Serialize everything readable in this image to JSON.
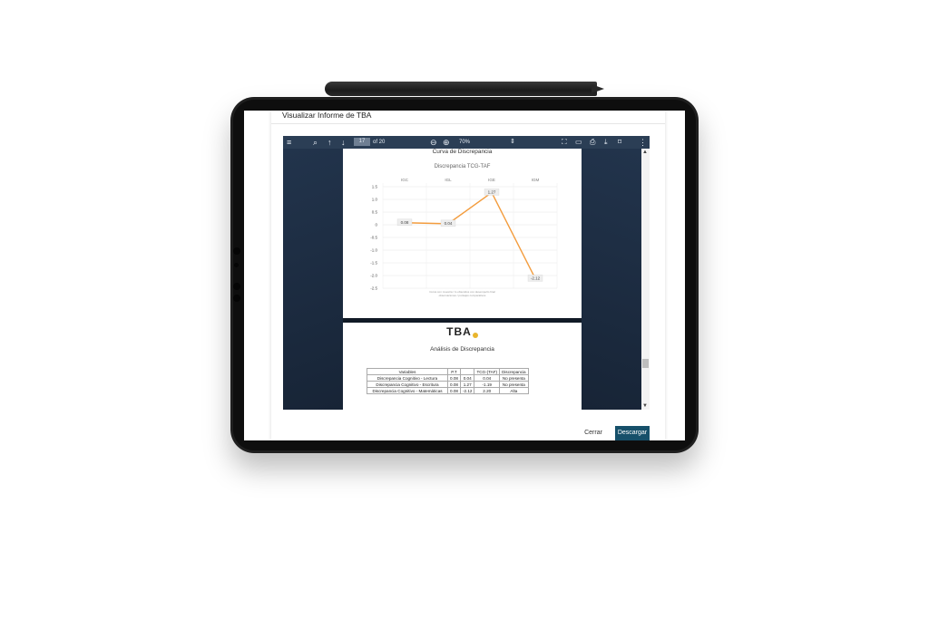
{
  "modal": {
    "title": "Visualizar Informe de TBA",
    "close_label": "Cerrar",
    "download_label": "Descargar"
  },
  "viewer": {
    "current_page": "17",
    "page_total": "of 20",
    "zoom": "70%",
    "icons": [
      "menu-icon",
      "search-icon",
      "arrow-up-icon",
      "arrow-down-icon",
      "zoom-out-icon",
      "zoom-in-icon",
      "fullscreen-icon",
      "open-folder-icon",
      "print-icon",
      "download-icon",
      "bookmark-icon",
      "more-icon"
    ]
  },
  "page1": {
    "heading": "Curva de Discrepancia",
    "note_line1": "Curva con muestra / lo obtenidos con desempeño final",
    "note_line2": "observaciones / puntajes comparativos"
  },
  "page2": {
    "logo_text": "TBA",
    "heading": "Análisis de Discrepancia",
    "table": {
      "headers": [
        "Variables",
        "P.T",
        "",
        "TCG-(TAF)",
        "Discrepancia"
      ],
      "rows": [
        [
          "Discrepancia Cognitivo - Lectura",
          "0.08",
          "0.04",
          "0.04",
          "No presenta"
        ],
        [
          "Discrepancia Cognitivo - Escritura",
          "0.08",
          "1.27",
          "-1.19",
          "No presenta"
        ],
        [
          "Discrepancia Cognitivo - Matemáticas",
          "0.08",
          "-2.12",
          "2.20",
          "Alta"
        ]
      ]
    }
  },
  "chart_data": {
    "type": "line",
    "title": "Discrepancia TCG-TAF",
    "categories": [
      "IGC",
      "IGL",
      "IGE",
      "IGM"
    ],
    "series": [
      {
        "values": [
          0.08,
          0.04,
          1.27,
          -2.12
        ],
        "color": "#f39c3d"
      }
    ],
    "data_labels": [
      "0.08",
      "0.04",
      "1.27",
      "-2.12"
    ],
    "yticks": [
      "1.5",
      "1.0",
      "0.5",
      "0",
      "-0.5",
      "-1.0",
      "-1.5",
      "-2.0",
      "-2.5"
    ],
    "ylim": [
      -2.5,
      1.5
    ],
    "grid": true,
    "xaxis_position": "top"
  }
}
